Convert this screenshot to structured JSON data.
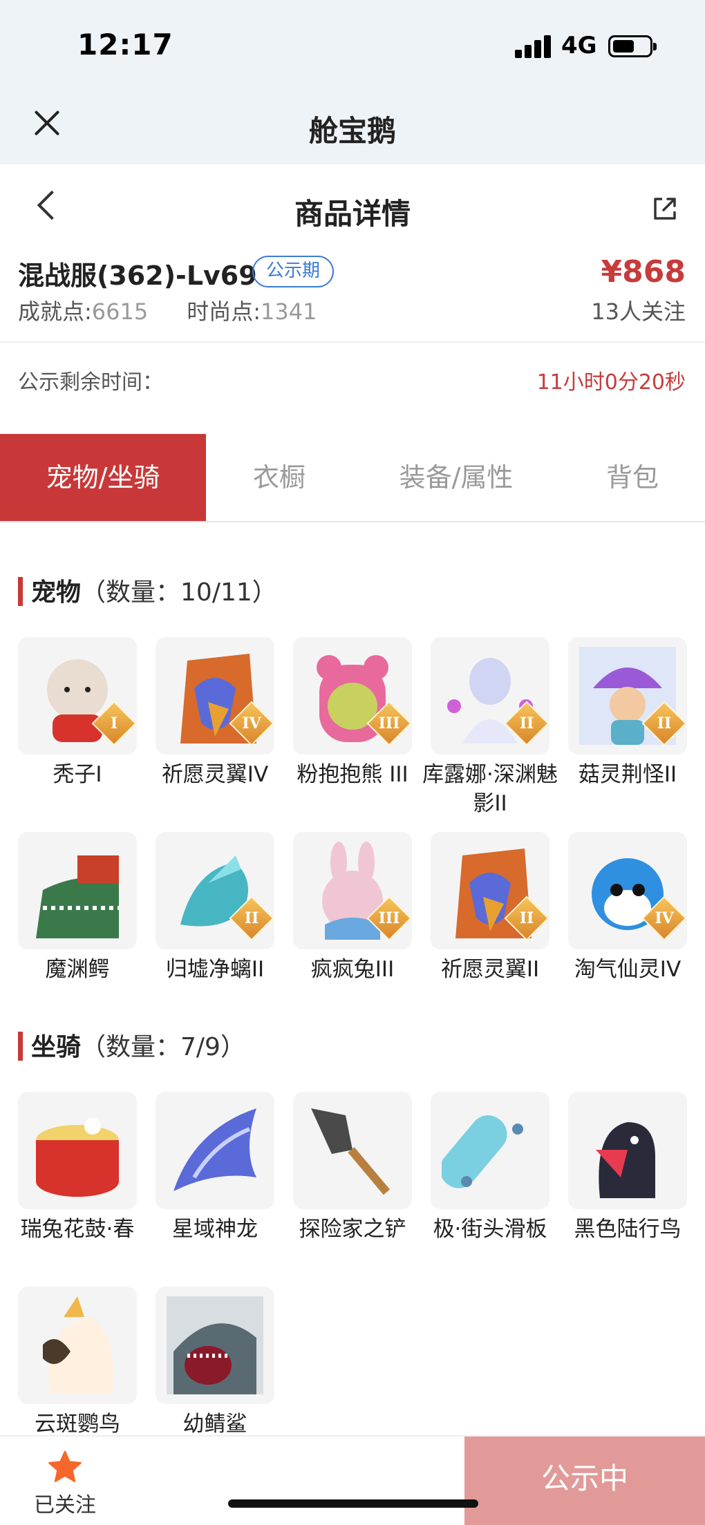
{
  "status": {
    "time": "12:17",
    "network": "4G"
  },
  "app": {
    "title": "舱宝鹅"
  },
  "page": {
    "title": "商品详情"
  },
  "product": {
    "name": "混战服(362)-Lv69",
    "badge": "公示期",
    "achievement_label": "成就点:",
    "achievement_value": "6615",
    "fashion_label": "时尚点:",
    "fashion_value": "1341",
    "price": "¥868",
    "followers": "13人关注"
  },
  "countdown": {
    "label": "公示剩余时间：",
    "value": "11小时0分20秒"
  },
  "tabs": [
    {
      "label": "宠物/坐骑",
      "active": true
    },
    {
      "label": "衣橱",
      "active": false
    },
    {
      "label": "装备/属性",
      "active": false
    },
    {
      "label": "背包",
      "active": false
    }
  ],
  "pets": {
    "title": "宠物",
    "count": "（数量：10/11）",
    "items": [
      {
        "name": "秃子I",
        "level": "I",
        "icon": "bald-head-icon",
        "color": "#e9dcd0"
      },
      {
        "name": "祈愿灵翼IV",
        "level": "IV",
        "icon": "bird-spirit-icon",
        "color": "#d86a2c"
      },
      {
        "name": "粉抱抱熊 III",
        "level": "III",
        "icon": "pink-bear-icon",
        "color": "#e86a9c"
      },
      {
        "name": "库露娜·深渊魅影II",
        "level": "II",
        "icon": "abyss-phantom-icon",
        "color": "#cfd5f2"
      },
      {
        "name": "菇灵荆怪II",
        "level": "II",
        "icon": "mushroom-sprite-icon",
        "color": "#9a5ad8"
      },
      {
        "name": "魔渊鳄",
        "level": "",
        "icon": "crocodile-icon",
        "color": "#3a7a4a"
      },
      {
        "name": "归墟净螭II",
        "level": "II",
        "icon": "dragon-icon",
        "color": "#46b6c2"
      },
      {
        "name": "疯疯兔III",
        "level": "III",
        "icon": "rabbit-icon",
        "color": "#f0c6d4"
      },
      {
        "name": "祈愿灵翼II",
        "level": "II",
        "icon": "bird-spirit-icon",
        "color": "#d86a2c"
      },
      {
        "name": "淘气仙灵IV",
        "level": "IV",
        "icon": "blue-puppy-icon",
        "color": "#2f8fe0"
      }
    ]
  },
  "mounts": {
    "title": "坐骑",
    "count": "（数量：7/9）",
    "items": [
      {
        "name": "瑞兔花鼓·春",
        "icon": "drum-icon",
        "color": "#d8322c"
      },
      {
        "name": "星域神龙",
        "icon": "star-dragon-icon",
        "color": "#5a6ad8"
      },
      {
        "name": "探险家之铲",
        "icon": "shovel-icon",
        "color": "#4a4a4a"
      },
      {
        "name": "极·街头滑板",
        "icon": "skateboard-icon",
        "color": "#7ad0e0"
      },
      {
        "name": "黑色陆行鸟",
        "icon": "black-bird-icon",
        "color": "#2a2a3a"
      },
      {
        "name": "云斑鹦鸟",
        "icon": "parrot-icon",
        "color": "#f0b84a"
      },
      {
        "name": "幼鲭鲨",
        "icon": "shark-icon",
        "color": "#5a6a72"
      }
    ]
  },
  "bottom": {
    "fav_label": "已关注",
    "status_label": "公示中"
  },
  "colors": {
    "accent": "#c93838",
    "price": "#c73b3b",
    "badge": "#3a7bd5",
    "status_button": "#e19a98",
    "star": "#f5672a"
  }
}
